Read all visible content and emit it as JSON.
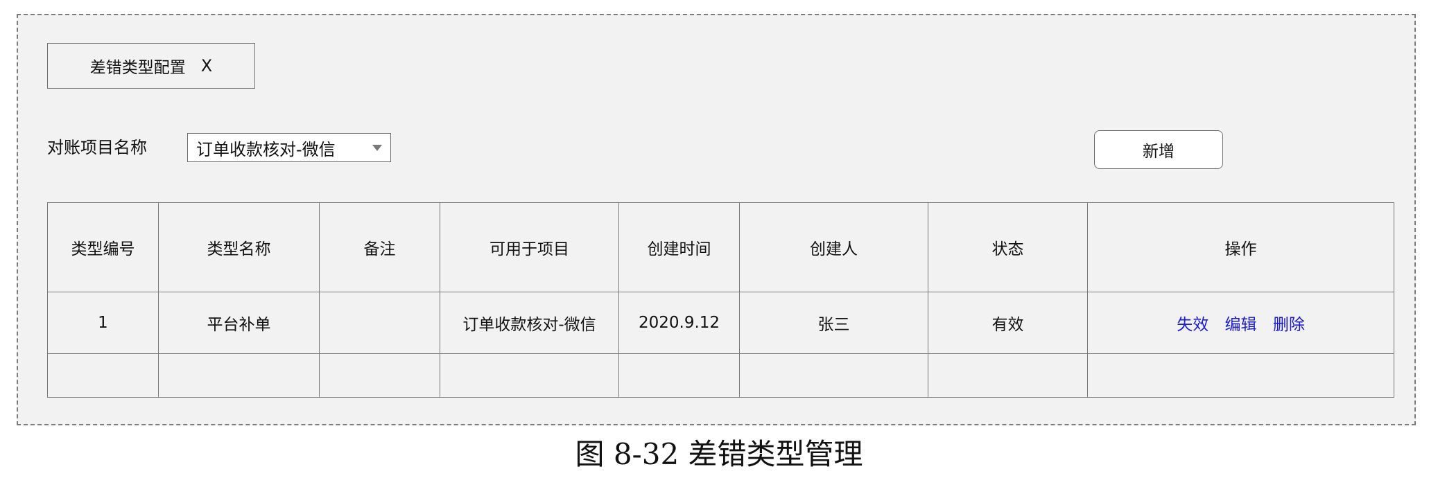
{
  "tab": {
    "title": "差错类型配置",
    "close_label": "X"
  },
  "filter": {
    "project_label": "对账项目名称",
    "project_selected": "订单收款核对-微信"
  },
  "toolbar": {
    "add_label": "新增"
  },
  "table": {
    "headers": [
      "类型编号",
      "类型名称",
      "备注",
      "可用于项目",
      "创建时间",
      "创建人",
      "状态",
      "操作"
    ],
    "rows": [
      {
        "id": "1",
        "name": "平台补单",
        "remark": "",
        "project": "订单收款核对-微信",
        "created_at": "2020.9.12",
        "creator": "张三",
        "status": "有效",
        "actions": {
          "deactivate": "失效",
          "edit": "编辑",
          "delete": "删除"
        }
      }
    ]
  },
  "caption": "图 8-32 差错类型管理",
  "colors": {
    "background": "#f2f2f2",
    "border": "#777777",
    "link": "#1b1bd6"
  },
  "icons": {
    "dropdown": "chevron-down-icon",
    "close": "close-icon"
  }
}
